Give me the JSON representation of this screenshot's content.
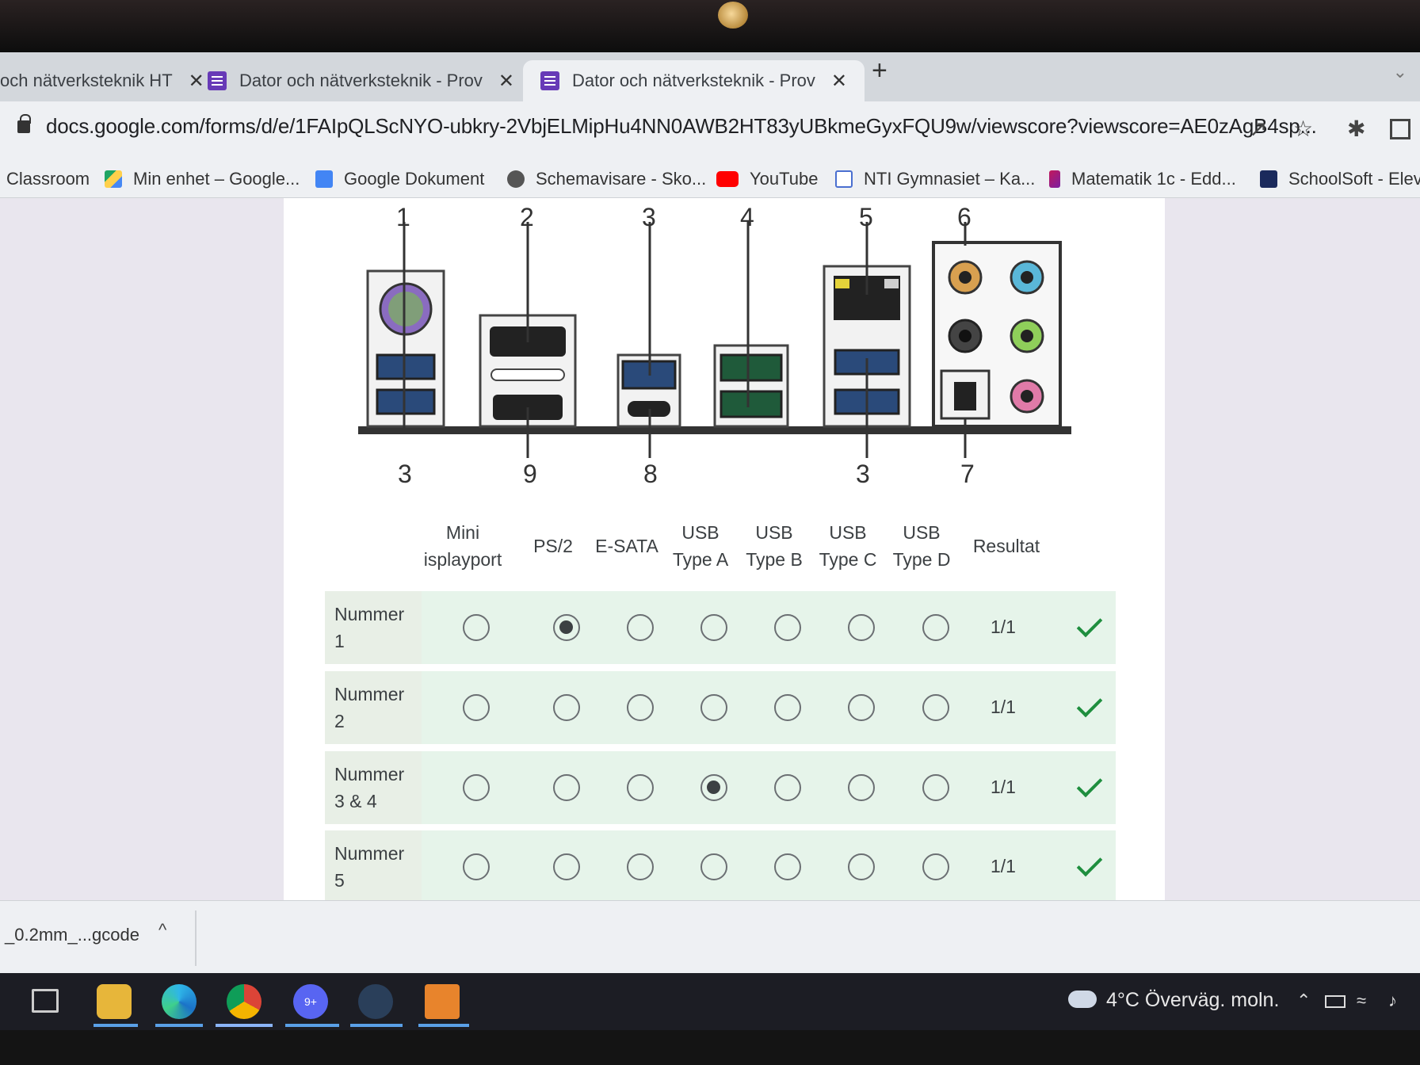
{
  "tabs": [
    {
      "title": "och nätverksteknik HT"
    },
    {
      "title": "Dator och nätverksteknik - Prov"
    },
    {
      "title": "Dator och nätverksteknik - Prov"
    }
  ],
  "tab_close": "✕",
  "new_tab": "+",
  "address": "docs.google.com/forms/d/e/1FAIpQLScNYO-ubkry-2VbjELMipHu4NN0AWB2HT83yUBkmeGyxFQU9w/viewscore?viewscore=AE0zAgB4sp...",
  "bookmarks": [
    {
      "label": "Classroom"
    },
    {
      "label": "Min enhet – Google..."
    },
    {
      "label": "Google Dokument"
    },
    {
      "label": "Schemavisare - Sko..."
    },
    {
      "label": "YouTube"
    },
    {
      "label": "NTI Gymnasiet – Ka..."
    },
    {
      "label": "Matematik 1c - Edd..."
    },
    {
      "label": "SchoolSoft - Elev"
    }
  ],
  "diagram": {
    "top_numbers": [
      "1",
      "2",
      "3",
      "4",
      "5",
      "6"
    ],
    "bottom_numbers": [
      "3",
      "9",
      "8",
      "3",
      "7"
    ]
  },
  "grid": {
    "columns": [
      {
        "line1": "Mini",
        "line2": "isplayport"
      },
      {
        "line1": "",
        "line2": "PS/2"
      },
      {
        "line1": "",
        "line2": "E-SATA"
      },
      {
        "line1": "USB",
        "line2": "Type A"
      },
      {
        "line1": "USB",
        "line2": "Type B"
      },
      {
        "line1": "USB",
        "line2": "Type C"
      },
      {
        "line1": "USB",
        "line2": "Type D"
      }
    ],
    "result_header": "Resultat",
    "rows": [
      {
        "line1": "Nummer",
        "line2": "1",
        "selected": 1,
        "score": "1/1"
      },
      {
        "line1": "Nummer",
        "line2": "2",
        "selected": -1,
        "score": "1/1"
      },
      {
        "line1": "Nummer",
        "line2": "3 & 4",
        "selected": 3,
        "score": "1/1"
      },
      {
        "line1": "Nummer",
        "line2": "5",
        "selected": -1,
        "score": "1/1"
      }
    ]
  },
  "download": {
    "file": "_0.2mm_...gcode",
    "chevron": "^"
  },
  "taskbar": {
    "weather": "4°C  Överväg. moln.",
    "chat_badge": "9+"
  }
}
